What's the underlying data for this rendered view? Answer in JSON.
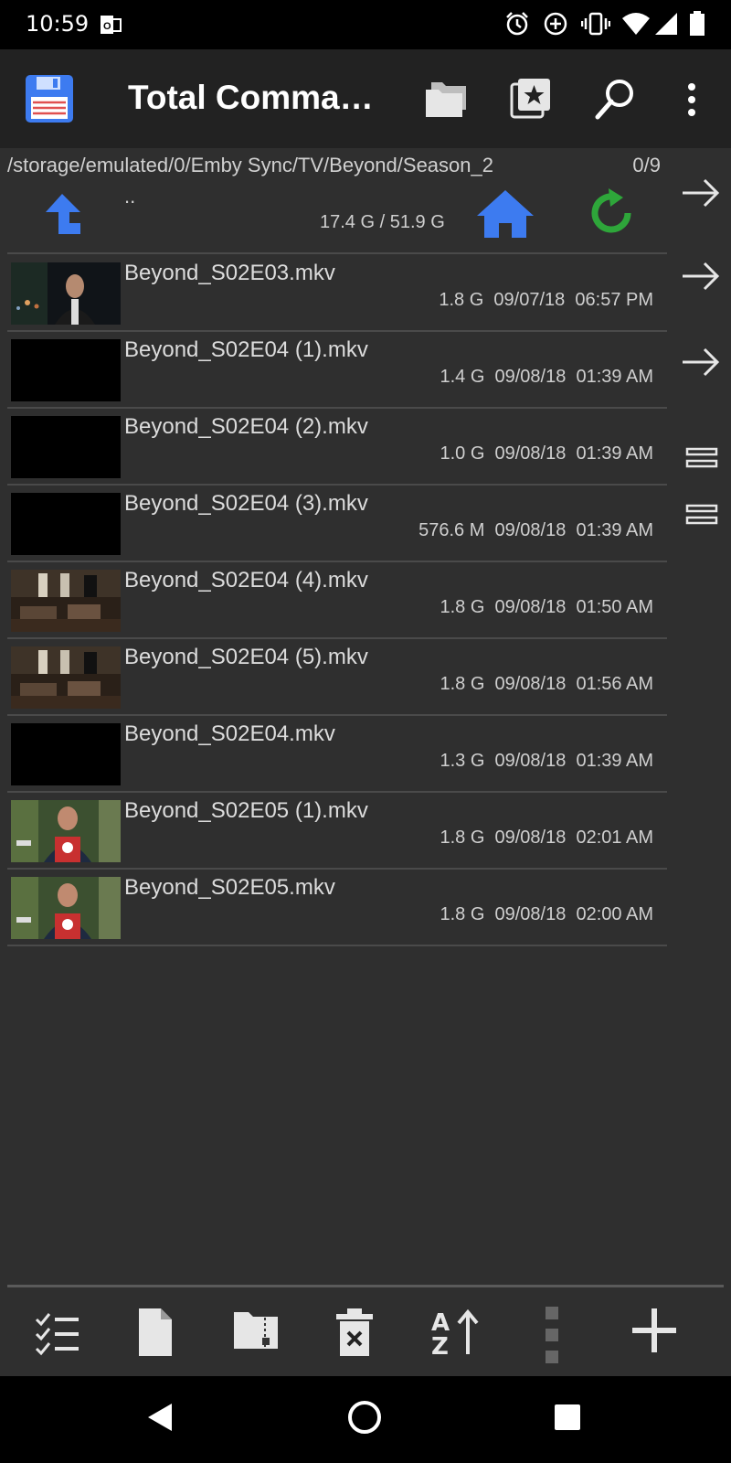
{
  "status_bar": {
    "time": "10:59",
    "icons": [
      "outlook-icon",
      "alarm-icon",
      "data-saver-icon",
      "vibrate-icon",
      "wifi-icon",
      "signal-icon",
      "battery-icon"
    ]
  },
  "app_bar": {
    "title": "Total Comman…",
    "icons": [
      "save-icon",
      "folders-icon",
      "bookmarks-icon",
      "search-icon",
      "more-vert-icon"
    ]
  },
  "panel": {
    "path": "/storage/emulated/0/Emby Sync/TV/Beyond/Season_2",
    "selection_count": "0/9",
    "parent_label": "..",
    "space": "17.4 G / 51.9 G"
  },
  "files": [
    {
      "name": "Beyond_S02E03.mkv",
      "size": "1.8 G",
      "date": "09/07/18",
      "time": "06:57 PM",
      "thumb": "person"
    },
    {
      "name": "Beyond_S02E04 (1).mkv",
      "size": "1.4 G",
      "date": "09/08/18",
      "time": "01:39 AM",
      "thumb": "black"
    },
    {
      "name": "Beyond_S02E04 (2).mkv",
      "size": "1.0 G",
      "date": "09/08/18",
      "time": "01:39 AM",
      "thumb": "black"
    },
    {
      "name": "Beyond_S02E04 (3).mkv",
      "size": "576.6 M",
      "date": "09/08/18",
      "time": "01:39 AM",
      "thumb": "black"
    },
    {
      "name": "Beyond_S02E04 (4).mkv",
      "size": "1.8 G",
      "date": "09/08/18",
      "time": "01:50 AM",
      "thumb": "room"
    },
    {
      "name": "Beyond_S02E04 (5).mkv",
      "size": "1.8 G",
      "date": "09/08/18",
      "time": "01:56 AM",
      "thumb": "room"
    },
    {
      "name": "Beyond_S02E04.mkv",
      "size": "1.3 G",
      "date": "09/08/18",
      "time": "01:39 AM",
      "thumb": "black"
    },
    {
      "name": "Beyond_S02E05 (1).mkv",
      "size": "1.8 G",
      "date": "09/08/18",
      "time": "02:01 AM",
      "thumb": "apron"
    },
    {
      "name": "Beyond_S02E05.mkv",
      "size": "1.8 G",
      "date": "09/08/18",
      "time": "02:00 AM",
      "thumb": "apron"
    }
  ],
  "side_buttons": [
    "arrow-right-icon",
    "arrow-right-icon",
    "arrow-right-icon",
    "equals-icon",
    "equals-icon"
  ],
  "bottom_toolbar": [
    "select-icon",
    "new-file-icon",
    "zip-icon",
    "delete-icon",
    "sort-icon",
    "drag-handle-icon",
    "add-icon"
  ],
  "nav_bar": [
    "back-icon",
    "home-icon",
    "recents-icon"
  ],
  "colors": {
    "accent_blue": "#3d7bf0",
    "refresh_green": "#2ea63a",
    "background": "#2f2f2f",
    "app_bar": "#222222"
  }
}
